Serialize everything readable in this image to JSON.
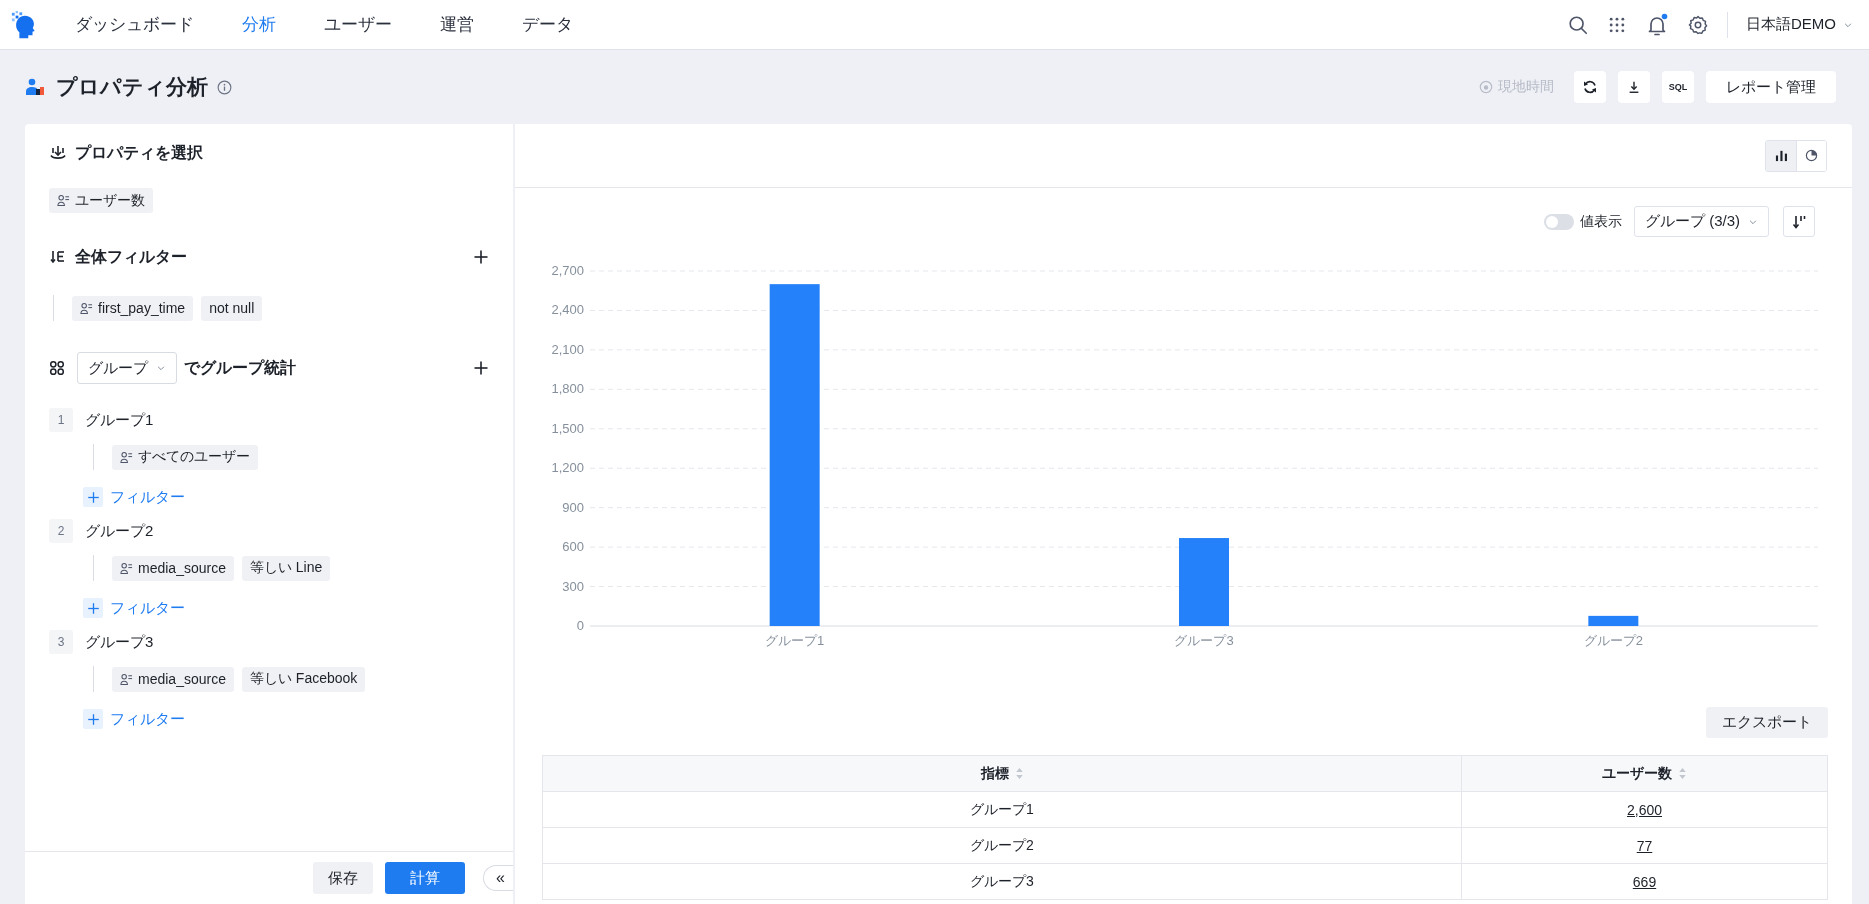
{
  "nav": {
    "items": [
      {
        "label": "ダッシュボード",
        "selected": false
      },
      {
        "label": "分析",
        "selected": true
      },
      {
        "label": "ユーザー",
        "selected": false
      },
      {
        "label": "運営",
        "selected": false
      },
      {
        "label": "データ",
        "selected": false
      }
    ],
    "user": "日本語DEMO"
  },
  "header": {
    "title": "プロパティ分析",
    "timezone": "現地時間",
    "sql_button": "SQL",
    "report_button": "レポート管理"
  },
  "config": {
    "property_section": {
      "title": "プロパティを選択",
      "chip": "ユーザー数"
    },
    "filter_section": {
      "title": "全体フィルター",
      "filters": [
        {
          "property": "first_pay_time",
          "condition": "not null"
        }
      ]
    },
    "group_section": {
      "select": "グループ",
      "title": "でグループ統計",
      "groups": [
        {
          "index": "1",
          "name": "グループ1",
          "filters": [
            {
              "property": "すべてのユーザー"
            }
          ],
          "add_filter": "フィルター"
        },
        {
          "index": "2",
          "name": "グループ2",
          "filters": [
            {
              "property": "media_source",
              "condition": "等しい Line"
            }
          ],
          "add_filter": "フィルター"
        },
        {
          "index": "3",
          "name": "グループ3",
          "filters": [
            {
              "property": "media_source",
              "condition": "等しい Facebook"
            }
          ],
          "add_filter": "フィルター"
        }
      ]
    },
    "save_button": "保存",
    "calc_button": "計算",
    "collapse_button": "«"
  },
  "result": {
    "chart_types": [
      {
        "kind": "bar",
        "selected": true
      },
      {
        "kind": "pie",
        "selected": false
      }
    ],
    "value_toggle": {
      "label": "値表示",
      "on": false
    },
    "group_select": "グループ (3/3)",
    "chart_data": {
      "type": "bar",
      "grid": true,
      "categories": [
        "グループ1",
        "グループ3",
        "グループ2"
      ],
      "values": [
        2600,
        669,
        77
      ],
      "ylim": [
        0,
        2700
      ],
      "yticks": [
        {
          "value": 0,
          "label": "0"
        },
        {
          "value": 300,
          "label": "300"
        },
        {
          "value": 600,
          "label": "600"
        },
        {
          "value": 900,
          "label": "900"
        },
        {
          "value": 1200,
          "label": "1,200"
        },
        {
          "value": 1500,
          "label": "1,500"
        },
        {
          "value": 1800,
          "label": "1,800"
        },
        {
          "value": 2100,
          "label": "2,100"
        },
        {
          "value": 2400,
          "label": "2,400"
        },
        {
          "value": 2700,
          "label": "2,700"
        }
      ]
    },
    "export_button": "エクスポート",
    "table": {
      "columns": [
        "指標",
        "ユーザー数"
      ],
      "rows": [
        [
          "グループ1",
          "2,600"
        ],
        [
          "グループ2",
          "77"
        ],
        [
          "グループ3",
          "669"
        ]
      ]
    }
  }
}
